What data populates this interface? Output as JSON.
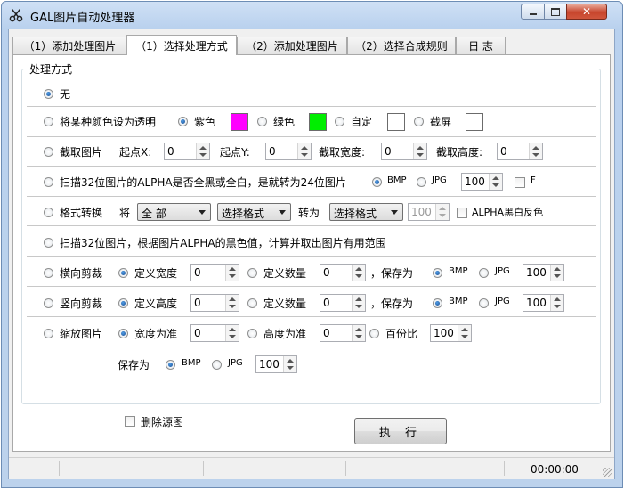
{
  "window": {
    "title": "GAL图片自动处理器",
    "minimize_icon": "minimize-icon",
    "maximize_icon": "maximize-icon",
    "close_icon": "close-icon",
    "app_icon": "scissors-icon"
  },
  "tabs": [
    {
      "label": "（1）添加处理图片"
    },
    {
      "label": "（1）选择处理方式"
    },
    {
      "label": "（2）添加处理图片"
    },
    {
      "label": "（2）选择合成规则"
    },
    {
      "label": "日 志"
    }
  ],
  "group_title": "处理方式",
  "rows": {
    "none": {
      "label": "无"
    },
    "transparent": {
      "label": "将某种颜色设为透明",
      "purple": "紫色",
      "green": "绿色",
      "custom": "自定",
      "screenshot": "截屏",
      "purple_color": "#ff00ff",
      "green_color": "#00ee00"
    },
    "crop": {
      "label": "截取图片",
      "x_label": "起点X:",
      "x": "0",
      "y_label": "起点Y:",
      "y": "0",
      "w_label": "截取宽度:",
      "w": "0",
      "h_label": "截取高度:",
      "h": "0"
    },
    "alpha": {
      "label": "扫描32位图片的ALPHA是否全黑或全白，是就转为24位图片",
      "bmp": "BMP",
      "jpg": "JPG",
      "quality": "100",
      "f": "F"
    },
    "convert": {
      "label": "格式转换",
      "from_label": "将",
      "from": "全 部",
      "fmt1": "选择格式",
      "to_label": "转为",
      "fmt2": "选择格式",
      "quality": "100",
      "invert": "ALPHA黑白反色"
    },
    "scan": {
      "label": "扫描32位图片，根据图片ALPHA的黑色值，计算并取出图片有用范围"
    },
    "hcut": {
      "label": "横向剪裁",
      "opt1": "定义宽度",
      "v1": "0",
      "opt2": "定义数量",
      "v2": "0",
      "save": "，保存为",
      "bmp": "BMP",
      "jpg": "JPG",
      "quality": "100"
    },
    "vcut": {
      "label": "竖向剪裁",
      "opt1": "定义高度",
      "v1": "0",
      "opt2": "定义数量",
      "v2": "0",
      "save": "，保存为",
      "bmp": "BMP",
      "jpg": "JPG",
      "quality": "100"
    },
    "scale": {
      "label": "缩放图片",
      "opt1": "宽度为准",
      "v1": "0",
      "opt2": "高度为准",
      "v2": "0",
      "opt3": "百份比",
      "v3": "100",
      "save": "保存为",
      "bmp": "BMP",
      "jpg": "JPG",
      "quality": "100"
    }
  },
  "delete_source": "删除源图",
  "execute": "执 行",
  "status": {
    "time": "00:00:00"
  }
}
